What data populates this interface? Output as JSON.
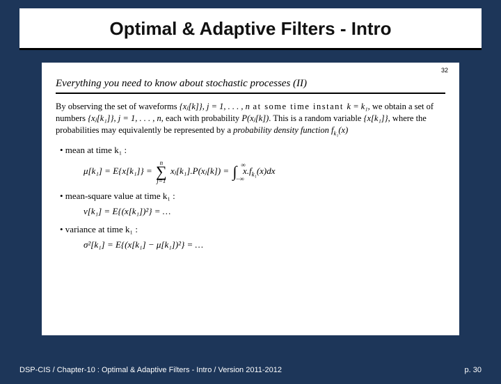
{
  "title": "Optimal & Adaptive Filters - Intro",
  "cornerPage": "32",
  "subtitle": "Everything you need to know about stochastic processes (II)",
  "para_parts": {
    "p1": "By observing the set of waveforms ",
    "p2": " at some time instant ",
    "p3": ", we obtain a set of numbers ",
    "p4": ", each with probability ",
    "p5": ". This is a random variable ",
    "p6": ", where the probabilities may equivalently be represented by a ",
    "p7": "probability density function "
  },
  "expr": {
    "set_xjk": "{xⱼ[k]}, j = 1, . . . , n",
    "k_eq_k1": "k = k₁",
    "set_xjk1": "{xⱼ[k₁]}, j = 1, . . . , n",
    "P_xjk": "P(xⱼ[k])",
    "rv": "{x[k₁]}",
    "pdf": "f_{k₁}(x)"
  },
  "bullets": {
    "mean": "• mean at time k₁ :",
    "msq": "• mean-square value at time k₁ :",
    "var": "• variance at time k₁ :"
  },
  "formulas": {
    "mean_lhs": "μ[k₁] = E{x[k₁]} = ",
    "mean_mid": " xⱼ[k₁].P(xⱼ[k]) = ",
    "mean_rhs": " x.f_{k₁}(x)dx",
    "sum_top": "n",
    "sum_bot": "j=1",
    "int_top": "∞",
    "int_bot": "−∞",
    "msq": "ν[k₁] = E{(x[k₁])²} = …",
    "var": "σ²[k₁] = E{(x[k₁] − μ[k₁])²} = …"
  },
  "footer": {
    "left": "DSP-CIS  /  Chapter-10 : Optimal & Adaptive Filters - Intro  /  Version 2011-2012",
    "right": "p. 30"
  }
}
